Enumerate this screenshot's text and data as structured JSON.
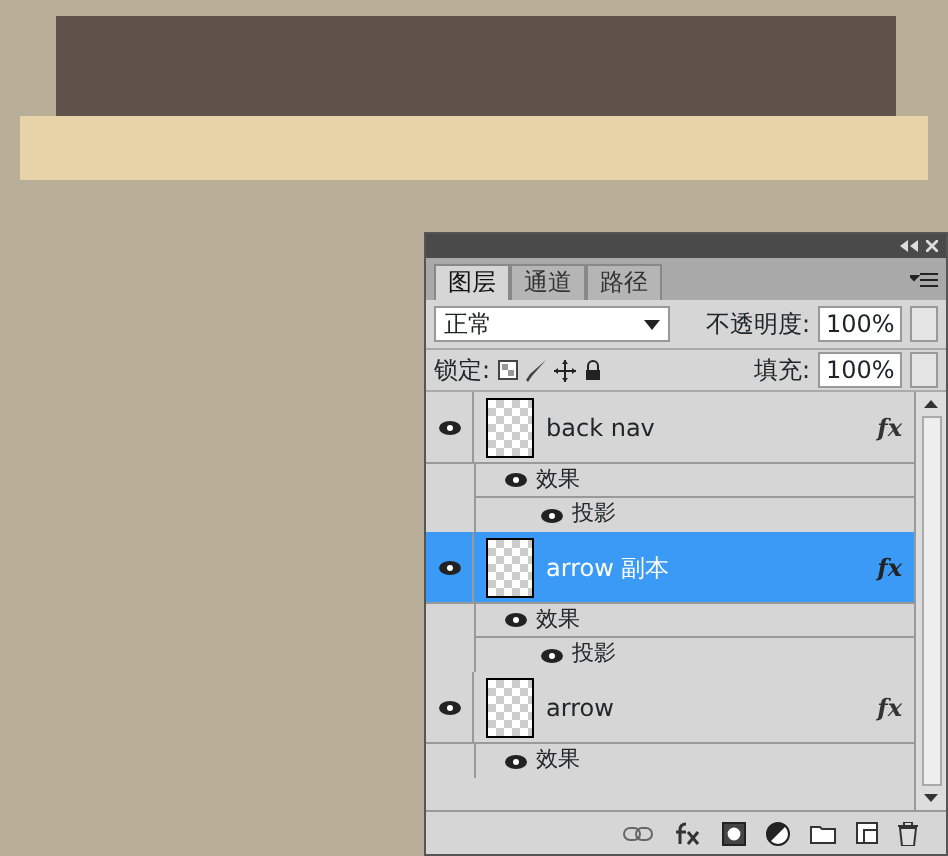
{
  "panel": {
    "tabs": [
      {
        "label": "图层",
        "selected": true
      },
      {
        "label": "通道",
        "selected": false
      },
      {
        "label": "路径",
        "selected": false
      }
    ],
    "blend_mode": "正常",
    "opacity_label": "不透明度:",
    "opacity_value": "100%",
    "lock_label": "锁定:",
    "fill_label": "填充:",
    "fill_value": "100%",
    "layers": [
      {
        "name": "back nav",
        "selected": false,
        "visible": true,
        "fx": "fx",
        "effects": [
          {
            "label": "效果",
            "visible": true,
            "children": [
              {
                "label": "投影",
                "visible": true
              }
            ]
          }
        ]
      },
      {
        "name": "arrow 副本",
        "selected": true,
        "visible": true,
        "fx": "fx",
        "effects": [
          {
            "label": "效果",
            "visible": true,
            "children": [
              {
                "label": "投影",
                "visible": true
              }
            ]
          }
        ]
      },
      {
        "name": "arrow",
        "selected": false,
        "visible": true,
        "fx": "fx",
        "effects": [
          {
            "label": "效果",
            "visible": true
          }
        ]
      }
    ]
  }
}
